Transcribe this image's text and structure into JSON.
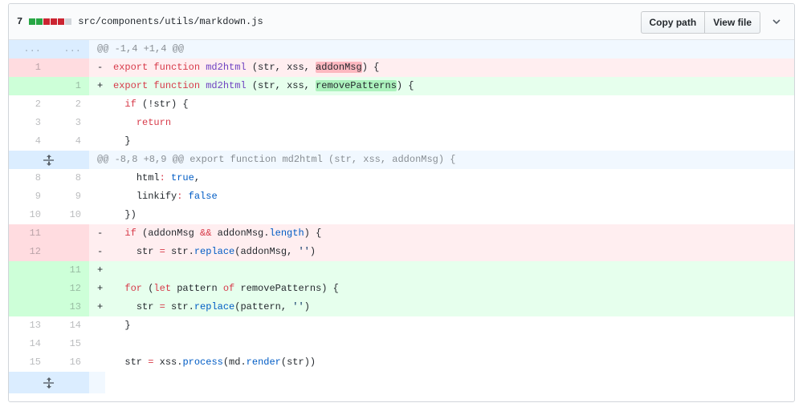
{
  "file": {
    "changes_count": "7",
    "diffstat": [
      "#28a745",
      "#28a745",
      "#cb2431",
      "#cb2431",
      "#cb2431",
      "#d1d5da"
    ],
    "path": "src/components/utils/markdown.js",
    "copy_path_label": "Copy path",
    "view_file_label": "View file",
    "toggle_icon": "chevron-down-icon"
  },
  "hunks": {
    "h1": {
      "left": "...",
      "right": "...",
      "text": "@@ -1,4 +1,4 @@"
    },
    "h2": {
      "text": "@@ -8,8 +8,9 @@ export function md2html (str, xss, addonMsg) {"
    }
  },
  "lines": {
    "l1": {
      "old": "1",
      "marker": "-"
    },
    "l2": {
      "new": "1",
      "marker": "+"
    },
    "l3": {
      "old": "2",
      "new": "2"
    },
    "l4": {
      "old": "3",
      "new": "3"
    },
    "l5": {
      "old": "4",
      "new": "4"
    },
    "l6": {
      "old": "8",
      "new": "8"
    },
    "l7": {
      "old": "9",
      "new": "9"
    },
    "l8": {
      "old": "10",
      "new": "10"
    },
    "l9": {
      "old": "11",
      "marker": "-"
    },
    "l10": {
      "old": "12",
      "marker": "-"
    },
    "l11": {
      "new": "11",
      "marker": "+"
    },
    "l12": {
      "new": "12",
      "marker": "+"
    },
    "l13": {
      "new": "13",
      "marker": "+"
    },
    "l14": {
      "old": "13",
      "new": "14"
    },
    "l15": {
      "old": "14",
      "new": "15"
    },
    "l16": {
      "old": "15",
      "new": "16"
    }
  },
  "tokens": {
    "export": "export",
    "function": "function",
    "md2html": "md2html",
    "params_a": " (str, xss, ",
    "addonMsg": "addonMsg",
    "removePatterns": "removePatterns",
    "params_end": ") {",
    "if": "if",
    "not_str": " (!str) {",
    "return": "return",
    "close_brace": "}",
    "html": "html",
    "colon": ": ",
    "true": "true",
    "comma": ",",
    "linkify": "linkify",
    "false": "false",
    "close_paren": "})",
    "if_open": " (addonMsg ",
    "and": "&&",
    "addon_dot": " addonMsg.",
    "length": "length",
    "brace_open": ") {",
    "str_assign": "str ",
    "eq": "=",
    "str_dot": " str.",
    "replace": "replace",
    "replace_args_a": "(addonMsg, ",
    "empty_str": "''",
    "rparen": ")",
    "for": "for",
    "paren_open": " (",
    "let": "let",
    "pattern": " pattern ",
    "of": "of",
    "remove_open": " removePatterns) {",
    "replace_args_b": "(pattern, ",
    "xss_process": " xss.",
    "process": "process",
    "md_open": "(md.",
    "render": "render",
    "render_args": "(str))"
  }
}
